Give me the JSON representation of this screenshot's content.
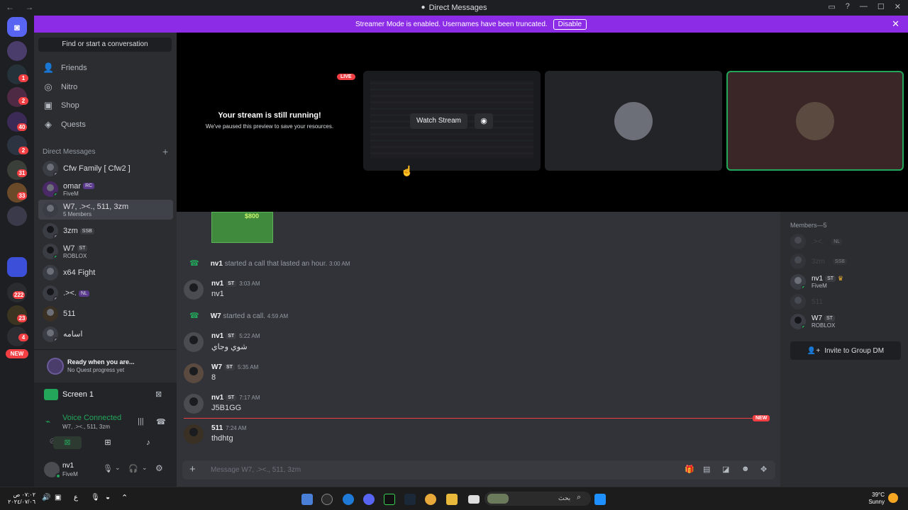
{
  "window": {
    "title": "Direct Messages"
  },
  "banner": {
    "text": "Streamer Mode is enabled. Usernames have been truncated.",
    "button": "Disable"
  },
  "servers": {
    "badges": [
      "1",
      "2",
      "40",
      "2",
      "31",
      "33",
      "222",
      "23",
      "4"
    ],
    "new_badge": "NEW"
  },
  "dm_panel": {
    "find": "Find or start a conversation",
    "nav": [
      {
        "label": "Friends",
        "icon": "friends-icon"
      },
      {
        "label": "Nitro",
        "icon": "nitro-icon"
      },
      {
        "label": "Shop",
        "icon": "shop-icon"
      },
      {
        "label": "Quests",
        "icon": "quests-icon"
      }
    ],
    "header": "Direct Messages",
    "items": [
      {
        "name": "Cfw Family [ Cfw2 ]",
        "sub": "",
        "tag": ""
      },
      {
        "name": "omar",
        "sub": "FiveM",
        "tag": "RC"
      },
      {
        "name": "W7, .><., 511, 3zm",
        "sub": "5 Members",
        "tag": ""
      },
      {
        "name": "3zm",
        "sub": "",
        "tag": "SSB"
      },
      {
        "name": "W7",
        "sub": "ROBLOX",
        "tag": "ST"
      },
      {
        "name": "x64 Fight",
        "sub": "",
        "tag": ""
      },
      {
        "name": ".><.",
        "sub": "",
        "tag": "NL"
      },
      {
        "name": "511",
        "sub": "",
        "tag": ""
      },
      {
        "name": "اسامه",
        "sub": "",
        "tag": ""
      }
    ]
  },
  "quest": {
    "title": "Ready when you are...",
    "sub": "No Quest progress yet"
  },
  "screen_share": {
    "label": "Screen 1"
  },
  "voice": {
    "status": "Voice Connected",
    "channel": "W7, .><., 511, 3zm"
  },
  "user": {
    "name": "nv1",
    "status": "FiveM"
  },
  "stage": {
    "live": "LIVE",
    "title": "Your stream is still running!",
    "subtitle": "We've paused this preview to save your resources.",
    "watch": "Watch Stream"
  },
  "chat": {
    "image_label": "$800",
    "events": [
      {
        "user": "nv1",
        "text": "started a call that lasted an hour.",
        "time": "3:00 AM"
      },
      {
        "user": "W7",
        "text": "started a call.",
        "time": "4:59 AM"
      }
    ],
    "messages": [
      {
        "user": "nv1",
        "tag": "ST",
        "time": "3:03 AM",
        "text": "nv1"
      },
      {
        "user": "nv1",
        "tag": "ST",
        "time": "5:22 AM",
        "text": "شوي وجاي"
      },
      {
        "user": "W7",
        "tag": "ST",
        "time": "5:35 AM",
        "text": "8"
      },
      {
        "user": "nv1",
        "tag": "ST",
        "time": "7:17 AM",
        "text": "J5B1GG"
      },
      {
        "user": "511",
        "tag": "",
        "time": "7:24 AM",
        "text": "thdhtg"
      }
    ],
    "new_label": "NEW",
    "input_placeholder": "Message W7, .><., 511, 3zm"
  },
  "members": {
    "header": "Members—5",
    "list": [
      {
        "name": ".><.",
        "tag": "NL",
        "sub": ""
      },
      {
        "name": "3zm",
        "tag": "SSB",
        "sub": ""
      },
      {
        "name": "nv1",
        "tag": "ST",
        "sub": "FiveM"
      },
      {
        "name": "511",
        "tag": "",
        "sub": ""
      },
      {
        "name": "W7",
        "tag": "ST",
        "sub": "ROBLOX"
      }
    ],
    "invite": "Invite to Group DM"
  },
  "taskbar": {
    "time": "٠٧:٠٢ ص",
    "date": "٢٠٢٤/٠٧/٠٦",
    "lang": "ع",
    "search": "بحث",
    "temp": "39°C",
    "weather": "Sunny"
  }
}
